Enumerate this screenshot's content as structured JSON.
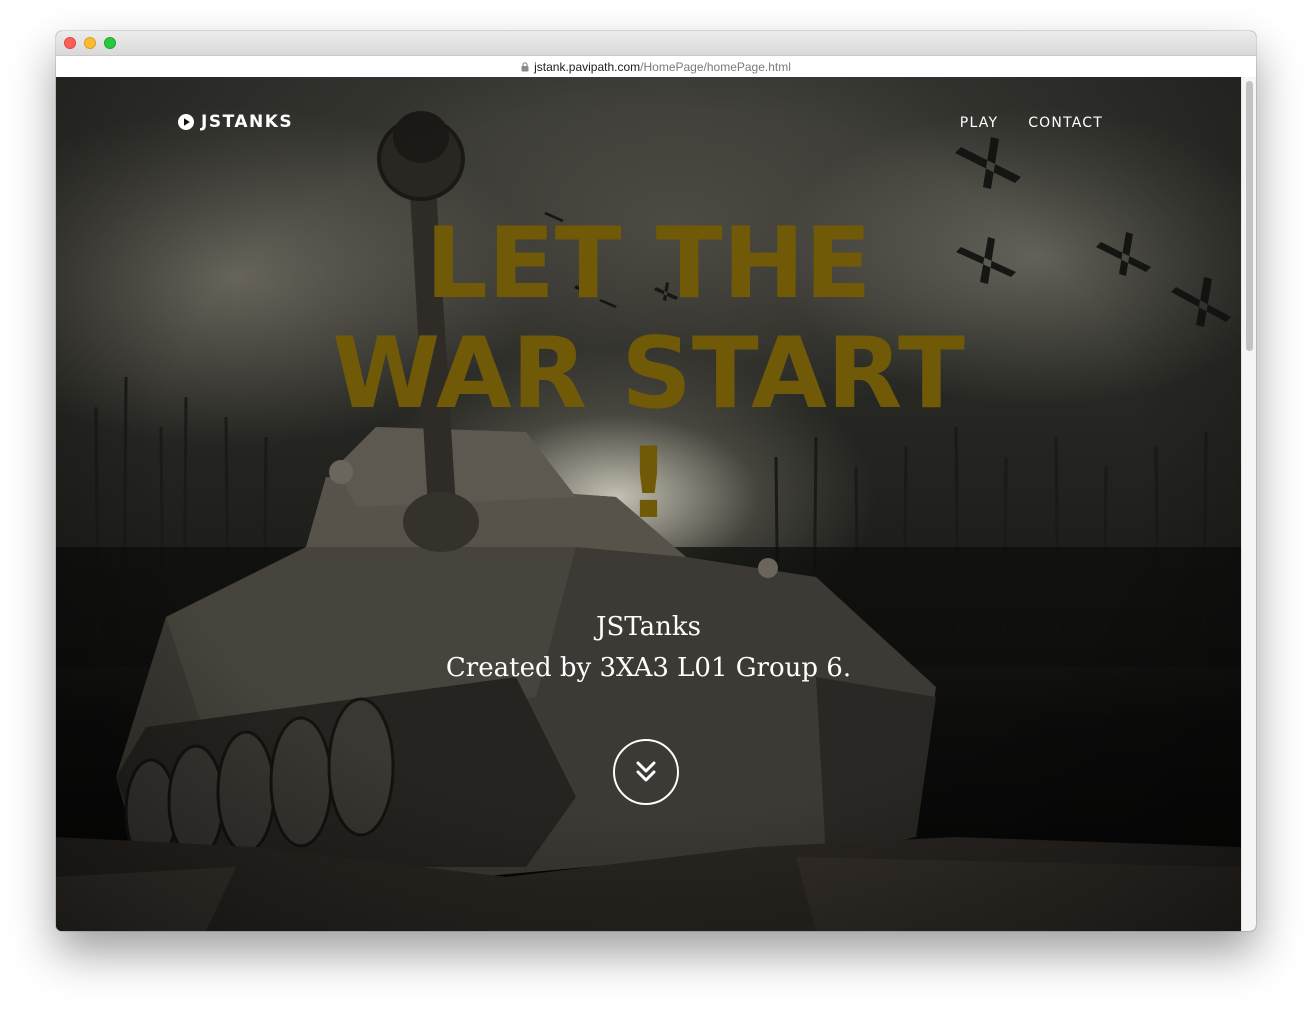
{
  "browser": {
    "url_host": "jstank.pavipath.com",
    "url_path": "/HomePage/homePage.html"
  },
  "nav": {
    "brand": "JSTANKS",
    "brand_icon": "play-circle-icon",
    "links": [
      "PLAY",
      "CONTACT"
    ]
  },
  "hero": {
    "headline_lines": [
      "LET THE",
      "WAR START",
      "!"
    ],
    "headline_color": "#705a08",
    "tagline_lines": [
      "JSTanks",
      "Created by 3XA3 L01 Group 6."
    ],
    "scroll_icon": "double-chevron-down-icon"
  }
}
